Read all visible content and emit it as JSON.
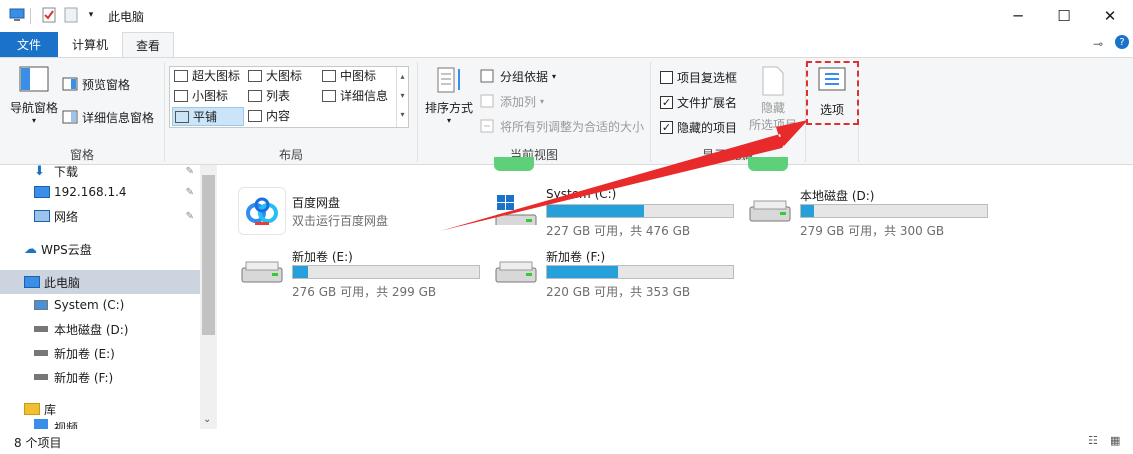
{
  "title": "此电脑",
  "tabs": [
    "文件",
    "计算机",
    "查看"
  ],
  "ribbon": {
    "pane": {
      "nav_pane": "导航窗格",
      "preview_pane": "预览窗格",
      "details_pane": "详细信息窗格",
      "group": "窗格"
    },
    "layout": {
      "items": [
        "超大图标",
        "大图标",
        "中图标",
        "小图标",
        "列表",
        "详细信息",
        "平铺",
        "内容"
      ],
      "selected": "平铺",
      "group": "布局"
    },
    "current_view": {
      "sort": "排序方式",
      "group_by": "分组依据",
      "add_column": "添加列",
      "fit_columns": "将所有列调整为合适的大小",
      "group": "当前视图"
    },
    "show_hide": {
      "item_checkbox": "项目复选框",
      "file_ext": "文件扩展名",
      "hidden_items": "隐藏的项目",
      "hide_btn_1": "隐藏",
      "hide_btn_2": "所选项目",
      "group_part": "显示/隐藏"
    },
    "options": "选项"
  },
  "nav": {
    "items": [
      {
        "label": "下载",
        "icon": "download-arrow-icon",
        "pinned": true
      },
      {
        "label": "192.168.1.4",
        "icon": "monitor-icon",
        "pinned": true
      },
      {
        "label": "网络",
        "icon": "network-icon",
        "pinned": true
      },
      {
        "label": "WPS云盘",
        "icon": "cloud-icon",
        "pinned": false
      },
      {
        "label": "此电脑",
        "icon": "monitor-icon",
        "pinned": false
      },
      {
        "label": "System (C:)",
        "icon": "windows-drive-icon",
        "pinned": false
      },
      {
        "label": "本地磁盘 (D:)",
        "icon": "drive-icon",
        "pinned": false
      },
      {
        "label": "新加卷 (E:)",
        "icon": "drive-icon",
        "pinned": false
      },
      {
        "label": "新加卷 (F:)",
        "icon": "drive-icon",
        "pinned": false
      },
      {
        "label": "库",
        "icon": "library-folder-icon",
        "pinned": false
      },
      {
        "label": "视频",
        "icon": "video-folder-icon",
        "pinned": false
      }
    ]
  },
  "content": {
    "app": {
      "name": "百度网盘",
      "desc": "双击运行百度网盘"
    },
    "drives": [
      {
        "name": "System (C:)",
        "free": "227 GB 可用，共 476 GB",
        "used_fraction": 0.52
      },
      {
        "name": "本地磁盘 (D:)",
        "free": "279 GB 可用，共 300 GB",
        "used_fraction": 0.07
      },
      {
        "name": "新加卷 (E:)",
        "free": "276 GB 可用，共 299 GB",
        "used_fraction": 0.08
      },
      {
        "name": "新加卷 (F:)",
        "free": "220 GB 可用，共 353 GB",
        "used_fraction": 0.38
      }
    ]
  },
  "status": {
    "count": "8 个项目"
  },
  "colors": {
    "accent": "#1a73c8",
    "drive_fill": "#26a0da",
    "annotation": "#e03131"
  }
}
